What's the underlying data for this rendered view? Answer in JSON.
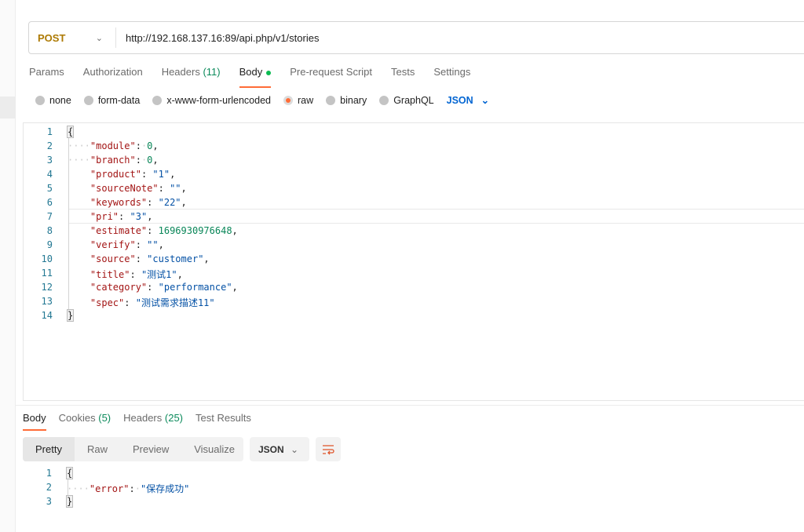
{
  "request": {
    "method": "POST",
    "url": "http://192.168.137.16:89/api.php/v1/stories",
    "tabs": [
      {
        "label": "Params"
      },
      {
        "label": "Authorization"
      },
      {
        "label": "Headers",
        "count": "(11)"
      },
      {
        "label": "Body"
      },
      {
        "label": "Pre-request Script"
      },
      {
        "label": "Tests"
      },
      {
        "label": "Settings"
      }
    ],
    "body_types": [
      "none",
      "form-data",
      "x-www-form-urlencoded",
      "raw",
      "binary",
      "GraphQL"
    ],
    "selected_body_type": "raw",
    "language": "JSON",
    "body_lines": [
      "{",
      "    \"module\": 0,",
      "    \"branch\": 0,",
      "\t\"product\": \"1\",",
      "\t\"sourceNote\": \"\",",
      "\t\"keywords\": \"22\",",
      "\t\"pri\": \"3\",",
      "\t\"estimate\": 1696930976648,",
      "\t\"verify\": \"\",",
      "\t\"source\": \"customer\",",
      "\t\"title\": \"测试1\",",
      "\t\"category\": \"performance\",",
      "\t\"spec\": \"测试需求描述11\"",
      "}"
    ]
  },
  "response": {
    "tabs": [
      {
        "label": "Body"
      },
      {
        "label": "Cookies",
        "count": "(5)"
      },
      {
        "label": "Headers",
        "count": "(25)"
      },
      {
        "label": "Test Results"
      }
    ],
    "views": [
      "Pretty",
      "Raw",
      "Preview",
      "Visualize"
    ],
    "format": "JSON",
    "body_lines": [
      "{",
      "    \"error\": \"保存成功\"",
      "}"
    ]
  },
  "colors": {
    "accent": "#ff6c37",
    "method": "#ad7a03",
    "key": "#a31515",
    "string": "#0451a5",
    "number": "#098658"
  }
}
